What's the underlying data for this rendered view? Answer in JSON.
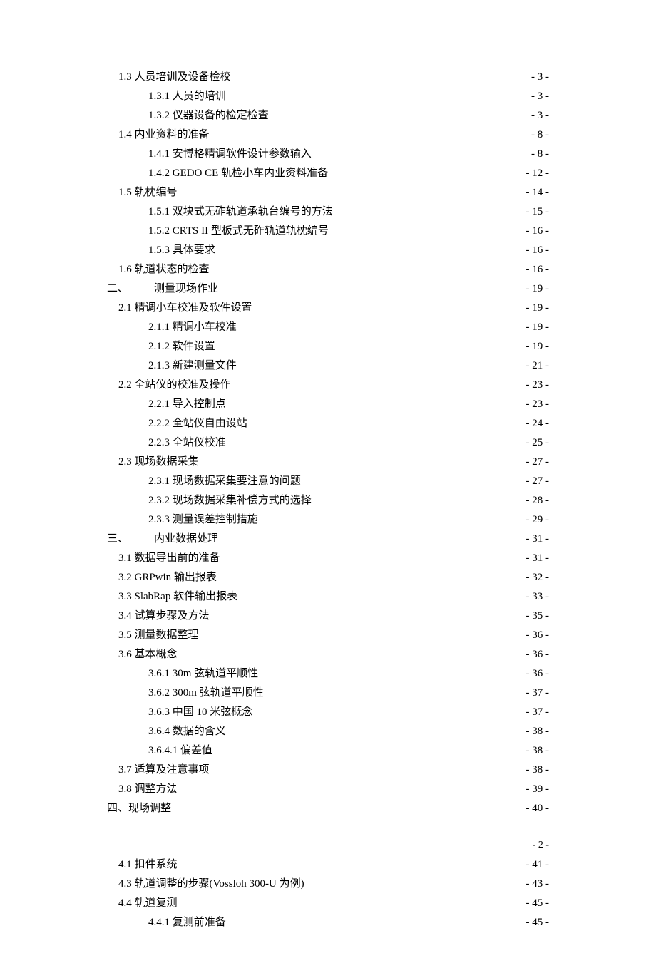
{
  "toc": [
    {
      "indent": 1,
      "label": "1.3 人员培训及设备检校",
      "page": "- 3 -"
    },
    {
      "indent": 2,
      "label": "1.3.1 人员的培训",
      "page": "- 3 -"
    },
    {
      "indent": 2,
      "label": "1.3.2 仪器设备的检定检查",
      "page": "- 3 -"
    },
    {
      "indent": 1,
      "label": "1.4 内业资料的准备",
      "page": "- 8 -"
    },
    {
      "indent": 2,
      "label": "1.4.1 安博格精调软件设计参数输入",
      "page": "- 8 -"
    },
    {
      "indent": 2,
      "label": "1.4.2 GEDO CE 轨检小车内业资料准备",
      "page": "- 12 -"
    },
    {
      "indent": 1,
      "label": "1.5 轨枕编号",
      "page": "- 14 -"
    },
    {
      "indent": 2,
      "label": "1.5.1 双块式无砟轨道承轨台编号的方法",
      "page": "- 15 -"
    },
    {
      "indent": 2,
      "label": "1.5.2 CRTS II 型板式无砟轨道轨枕编号",
      "page": "- 16 -"
    },
    {
      "indent": 2,
      "label": "1.5.3 具体要求",
      "page": "- 16 -"
    },
    {
      "indent": 1,
      "label": "1.6 轨道状态的检查",
      "page": "- 16 -"
    },
    {
      "indent": 0,
      "major": true,
      "label_prefix": "二、",
      "label": "测量现场作业",
      "page": "- 19 -"
    },
    {
      "indent": 1,
      "label": "2.1 精调小车校准及软件设置",
      "page": "- 19 -"
    },
    {
      "indent": 2,
      "label": "2.1.1 精调小车校准",
      "page": "- 19 -"
    },
    {
      "indent": 2,
      "label": "2.1.2 软件设置",
      "page": "- 19 -"
    },
    {
      "indent": 2,
      "label": "2.1.3 新建测量文件",
      "page": "- 21 -"
    },
    {
      "indent": 1,
      "label": "2.2 全站仪的校准及操作",
      "page": "- 23 -"
    },
    {
      "indent": 2,
      "label": "2.2.1 导入控制点",
      "page": "- 23 -"
    },
    {
      "indent": 2,
      "label": "2.2.2 全站仪自由设站",
      "page": "- 24 -"
    },
    {
      "indent": 2,
      "label": "2.2.3 全站仪校准",
      "page": "- 25 -"
    },
    {
      "indent": 1,
      "label": "2.3 现场数据采集",
      "page": "- 27 -"
    },
    {
      "indent": 2,
      "label": "2.3.1 现场数据采集要注意的问题",
      "page": "- 27 -"
    },
    {
      "indent": 2,
      "label": "2.3.2 现场数据采集补偿方式的选择",
      "page": "- 28 -"
    },
    {
      "indent": 2,
      "label": "2.3.3 测量误差控制措施",
      "page": "- 29 -"
    },
    {
      "indent": 0,
      "major": true,
      "label_prefix": "三、",
      "label": "内业数据处理",
      "page": "- 31 -"
    },
    {
      "indent": 1,
      "label": "3.1 数据导出前的准备",
      "page": "- 31 -"
    },
    {
      "indent": 1,
      "label": "3.2 GRPwin 输出报表",
      "page": "- 32 -"
    },
    {
      "indent": 1,
      "label": "3.3 SlabRap 软件输出报表",
      "page": "- 33 -"
    },
    {
      "indent": 1,
      "label": "3.4 试算步骤及方法",
      "page": "- 35 -"
    },
    {
      "indent": 1,
      "label": "3.5 测量数据整理",
      "page": "- 36 -"
    },
    {
      "indent": 1,
      "label": "3.6 基本概念",
      "page": "- 36 -"
    },
    {
      "indent": 2,
      "label": "3.6.1 30m 弦轨道平顺性",
      "page": "- 36 -"
    },
    {
      "indent": 2,
      "label": "3.6.2 300m 弦轨道平顺性",
      "page": "- 37 -"
    },
    {
      "indent": 2,
      "label": "3.6.3 中国 10 米弦概念",
      "page": "- 37 -"
    },
    {
      "indent": 2,
      "label": "3.6.4 数据的含义",
      "page": "- 38 -"
    },
    {
      "indent": 2,
      "label": "3.6.4.1 偏差值",
      "page": "- 38 -"
    },
    {
      "indent": 1,
      "label": "3.7 适算及注意事项",
      "page": "- 38 -"
    },
    {
      "indent": 1,
      "label": "3.8 调整方法",
      "page": "- 39 -"
    },
    {
      "indent": 0,
      "plain": true,
      "label": "四、现场调整 ",
      "page": "- 40 -"
    }
  ],
  "footer_page": "- 2 -",
  "toc2": [
    {
      "indent": 1,
      "label": "4.1 扣件系统",
      "page": "- 41 -"
    },
    {
      "indent": 1,
      "label": "4.3 轨道调整的步骤(Vossloh 300-U 为例)",
      "page": "- 43 -"
    },
    {
      "indent": 1,
      "label": "4.4 轨道复测",
      "page": "- 45 -"
    },
    {
      "indent": 2,
      "label": "4.4.1 复测前准备",
      "page": "- 45 -"
    }
  ]
}
